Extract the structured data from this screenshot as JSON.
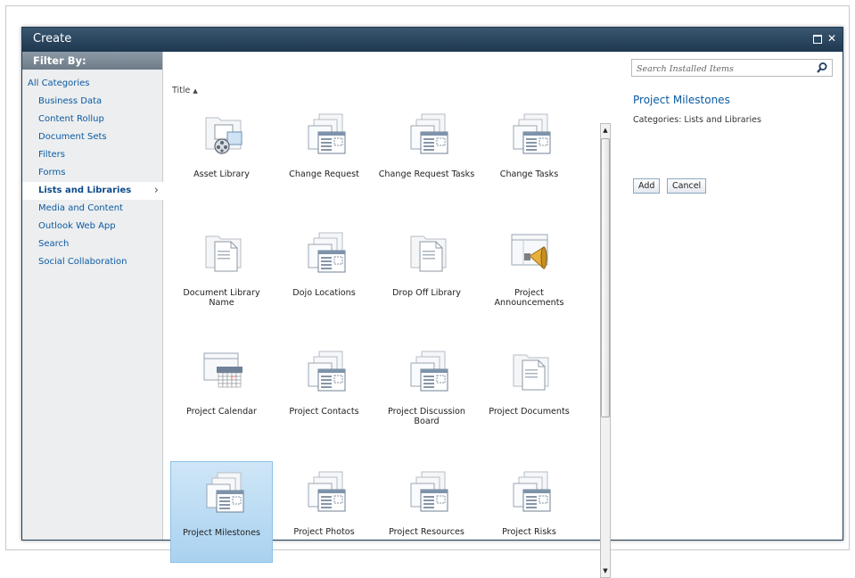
{
  "dialog": {
    "title": "Create"
  },
  "filter": {
    "header": "Filter By:",
    "categories": [
      {
        "label": "All Categories"
      },
      {
        "label": "Business Data"
      },
      {
        "label": "Content Rollup"
      },
      {
        "label": "Document Sets"
      },
      {
        "label": "Filters"
      },
      {
        "label": "Forms"
      },
      {
        "label": "Lists and Libraries"
      },
      {
        "label": "Media and Content"
      },
      {
        "label": "Outlook Web App"
      },
      {
        "label": "Search"
      },
      {
        "label": "Social Collaboration"
      }
    ],
    "selected": "Lists and Libraries"
  },
  "gallery": {
    "sort_label": "Title",
    "sort_direction": "ascending",
    "items": [
      {
        "label": "Asset Library",
        "icon": "asset-library-icon"
      },
      {
        "label": "Change Request",
        "icon": "list-template-icon"
      },
      {
        "label": "Change Request Tasks",
        "icon": "list-template-icon"
      },
      {
        "label": "Change Tasks",
        "icon": "list-template-icon"
      },
      {
        "label": "Document Library Name",
        "icon": "document-library-icon"
      },
      {
        "label": "Dojo Locations",
        "icon": "list-template-icon"
      },
      {
        "label": "Drop Off Library",
        "icon": "document-library-icon"
      },
      {
        "label": "Project Announcements",
        "icon": "announcements-icon"
      },
      {
        "label": "Project Calendar",
        "icon": "calendar-icon"
      },
      {
        "label": "Project Contacts",
        "icon": "list-template-icon"
      },
      {
        "label": "Project Discussion Board",
        "icon": "list-template-icon"
      },
      {
        "label": "Project Documents",
        "icon": "document-library-icon"
      },
      {
        "label": "Project Milestones",
        "icon": "list-template-icon",
        "selected": true
      },
      {
        "label": "Project Photos",
        "icon": "list-template-icon"
      },
      {
        "label": "Project Resources",
        "icon": "list-template-icon"
      },
      {
        "label": "Project Risks",
        "icon": "list-template-icon"
      }
    ]
  },
  "details": {
    "search_placeholder": "Search Installed Items",
    "title": "Project Milestones",
    "categories": "Categories: Lists and Libraries",
    "add_label": "Add",
    "cancel_label": "Cancel"
  }
}
